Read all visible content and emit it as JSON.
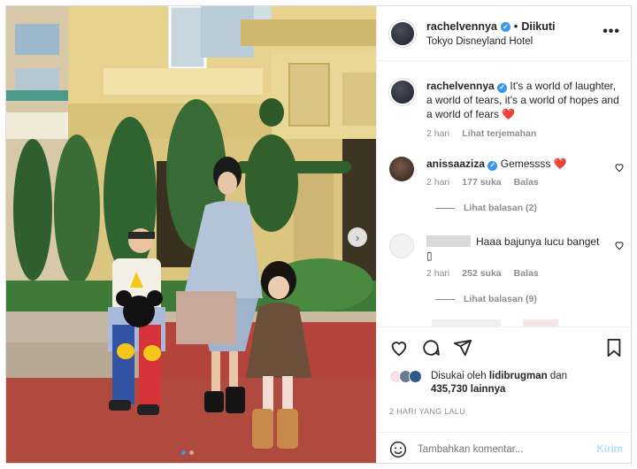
{
  "post": {
    "username": "rachelvennya",
    "follow_label": "Diikuti",
    "separator": "•",
    "location": "Tokyo Disneyland Hotel",
    "more_icon": "more-horizontal-icon"
  },
  "caption": {
    "username": "rachelvennya",
    "text": "It's a world of laughter, a world of tears, it's a world of hopes and a world of fears",
    "emoji": "❤️",
    "age": "2 hari",
    "translate": "Lihat terjemahan"
  },
  "comments": [
    {
      "username": "anissaaziza",
      "text": "Gemessss",
      "emoji": "❤️",
      "age": "2 hari",
      "likes": "177 suka",
      "reply": "Balas",
      "view_replies": "Lihat balasan (2)"
    },
    {
      "username": "",
      "text": "Haaa bajunya lucu banget",
      "trailing": "▯",
      "age": "2 hari",
      "likes": "252 suka",
      "reply": "Balas",
      "view_replies": "Lihat balasan (9)"
    }
  ],
  "likes": {
    "prefix": "Disukai oleh",
    "user": "lidibrugman",
    "conj": "dan",
    "count": "435,730 lainnya"
  },
  "timeago": "2 HARI YANG LALU",
  "add_comment": {
    "placeholder": "Tambahkan komentar...",
    "send": "Kirim"
  },
  "colors": {
    "accent_blue": "#3897f0",
    "heart_red": "#ed4956",
    "muted": "#8e8e8e",
    "send_disabled": "#b2dffc"
  },
  "carousel": {
    "slide_count": 2,
    "active_slide": 1
  }
}
